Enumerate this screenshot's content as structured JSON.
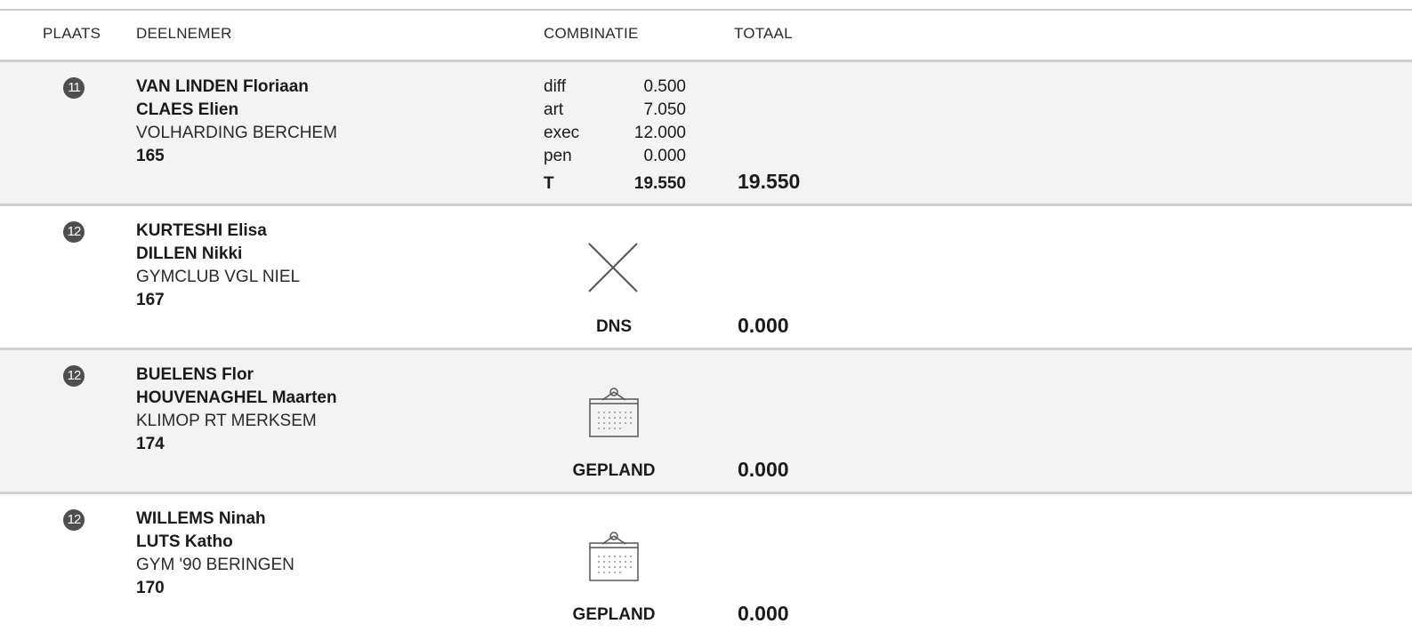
{
  "header": {
    "place": "PLAATS",
    "participant": "DEELNEMER",
    "combination": "COMBINATIE",
    "total": "TOTAAL"
  },
  "rows": [
    {
      "rank": "11",
      "name1": "VAN LINDEN Floriaan",
      "name2": "CLAES Elien",
      "club": "VOLHARDING BERCHEM",
      "number": "165",
      "scores": [
        {
          "label": "diff",
          "value": "0.500"
        },
        {
          "label": "art",
          "value": "7.050"
        },
        {
          "label": "exec",
          "value": "12.000"
        },
        {
          "label": "pen",
          "value": "0.000"
        }
      ],
      "subtotal_label": "T",
      "subtotal_value": "19.550",
      "total": "19.550"
    },
    {
      "rank": "12",
      "name1": "KURTESHI Elisa",
      "name2": "DILLEN Nikki",
      "club": "GYMCLUB VGL NIEL",
      "number": "167",
      "status_icon": "x-cross-icon",
      "status": "DNS",
      "total": "0.000"
    },
    {
      "rank": "12",
      "name1": "BUELENS Flor",
      "name2": "HOUVENAGHEL Maarten",
      "club": "KLIMOP RT MERKSEM",
      "number": "174",
      "status_icon": "calendar-icon",
      "status": "GEPLAND",
      "total": "0.000"
    },
    {
      "rank": "12",
      "name1": "WILLEMS Ninah",
      "name2": "LUTS Katho",
      "club": "GYM '90 BERINGEN",
      "number": "170",
      "status_icon": "calendar-icon",
      "status": "GEPLAND",
      "total": "0.000"
    }
  ],
  "colors": {
    "row_shade": "#f3f3f3",
    "divider": "#cfcfcf",
    "badge": "#4e4e4e"
  }
}
